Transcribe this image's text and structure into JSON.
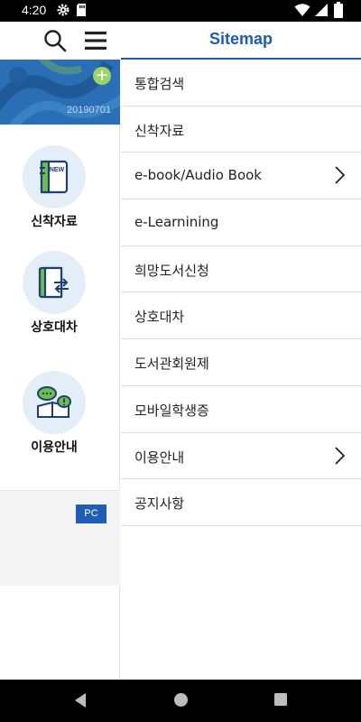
{
  "status_bar": {
    "time": "4:20"
  },
  "left_panel": {
    "banner_date": "20190701",
    "quick_links": [
      {
        "label": "신착자료",
        "icon": "new-book-icon"
      },
      {
        "label": "상호대차",
        "icon": "interlibrary-loan-icon"
      },
      {
        "label": "이용안내",
        "icon": "guide-speech-icon"
      }
    ],
    "pc_button": "PC"
  },
  "drawer": {
    "title": "Sitemap",
    "items": [
      {
        "label": "통합검색",
        "has_submenu": false
      },
      {
        "label": "신착자료",
        "has_submenu": false
      },
      {
        "label": "e-book/Audio Book",
        "has_submenu": true
      },
      {
        "label": "e-Learnining",
        "has_submenu": false
      },
      {
        "label": "희망도서신청",
        "has_submenu": false
      },
      {
        "label": "상호대차",
        "has_submenu": false
      },
      {
        "label": "도서관회원제",
        "has_submenu": false
      },
      {
        "label": "모바일학생증",
        "has_submenu": false
      },
      {
        "label": "이용안내",
        "has_submenu": true
      },
      {
        "label": "공지사항",
        "has_submenu": false
      }
    ]
  },
  "colors": {
    "accent": "#1e5bb5",
    "banner": "#2a6fb5",
    "plus": "#9bd36a",
    "icon_green": "#6cbf4a"
  }
}
